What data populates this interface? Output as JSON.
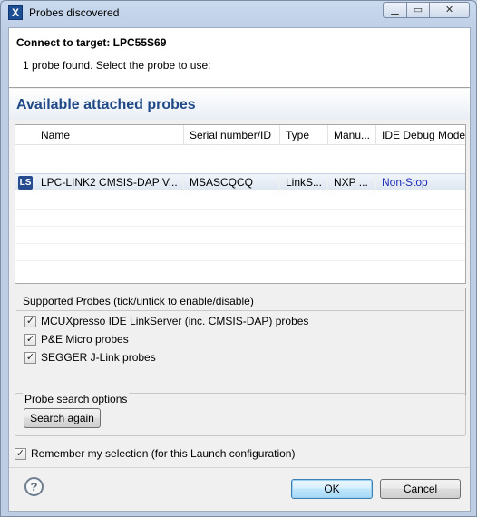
{
  "window": {
    "title": "Probes discovered"
  },
  "header": {
    "title": "Connect to target: LPC55S69",
    "message": "1 probe found. Select the probe to use:"
  },
  "section": {
    "title": "Available attached probes"
  },
  "table": {
    "columns": [
      "Name",
      "Serial number/ID",
      "Type",
      "Manu...",
      "IDE Debug Mode"
    ],
    "rows": [
      {
        "icon": "LS",
        "name": "LPC-LINK2 CMSIS-DAP V...",
        "serial": "MSASCQCQ",
        "type": "LinkS...",
        "manufacturer": "NXP ...",
        "mode": "Non-Stop"
      }
    ]
  },
  "supported": {
    "heading": "Supported Probes (tick/untick to enable/disable)",
    "items": [
      {
        "label": "MCUXpresso IDE LinkServer (inc. CMSIS-DAP) probes",
        "checked": true
      },
      {
        "label": "P&E Micro probes",
        "checked": true
      },
      {
        "label": "SEGGER J-Link probes",
        "checked": true
      }
    ]
  },
  "search": {
    "title": "Probe search options",
    "button": "Search again"
  },
  "remember": {
    "label": "Remember my selection (for this Launch configuration)",
    "checked": true
  },
  "footer": {
    "help": "?",
    "ok": "OK",
    "cancel": "Cancel"
  },
  "colors": {
    "section_title": "#204a87",
    "mode_link": "#1f2fb5",
    "ok_border": "#3c7fb1"
  }
}
